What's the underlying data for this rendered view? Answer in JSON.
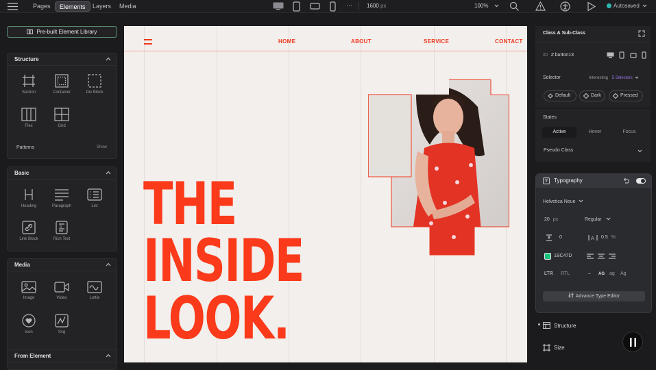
{
  "topbar": {
    "tabs": [
      "Pages",
      "Elements",
      "Layers",
      "Media"
    ],
    "active_tab": "Elements",
    "more": "···",
    "width_value": "1600",
    "width_unit": "px",
    "zoom": "100%",
    "autosave": "Autosaved"
  },
  "left": {
    "library_button": "Pre-built Element Library",
    "structure": {
      "title": "Structure",
      "items": [
        "Section",
        "Container",
        "Div Block",
        "Flex",
        "Grid"
      ],
      "patterns": "Patterns",
      "show": "Show"
    },
    "basic": {
      "title": "Basic",
      "items": [
        "Heading",
        "Paragraph",
        "List",
        "Link Block",
        "Rich Text"
      ]
    },
    "media": {
      "title": "Media",
      "items": [
        "Image",
        "Video",
        "Lottie",
        "Icon",
        "Svg"
      ]
    },
    "from_element": {
      "title": "From Element"
    }
  },
  "canvas": {
    "nav": [
      "HOME",
      "ABOUT",
      "SERVICE",
      "CONTACT"
    ],
    "hero": [
      "THE",
      "INSIDE",
      "LOOK."
    ],
    "accent": "#FA3A1A",
    "background": "#F2EFEC"
  },
  "right": {
    "class_title": "Class & Sub-Class",
    "id_label": "ID",
    "id_value": "# button13",
    "selector_label": "Selector",
    "selector_interesting": "Interesting",
    "selector_count": "5 Selectors",
    "selector_pills": [
      "Default",
      "Dark",
      "Pressed"
    ],
    "states_label": "States",
    "states": [
      "Active",
      "Hover",
      "Focus"
    ],
    "pseudo": "Pseudo Class",
    "typography": {
      "title": "Typography",
      "font": "Helvetica Neue",
      "size": "20",
      "size_unit": "px",
      "weight": "Regular",
      "line_height": "0",
      "letter_spacing": "0.5",
      "letter_unit": "%",
      "color": "1BC47D",
      "color_hex": "#1BC47D",
      "dir": [
        "LTR",
        "RTL"
      ],
      "case": [
        "–",
        "AG",
        "ag",
        "Ag"
      ],
      "advance": "Advance Type Editor"
    },
    "structure": "Structure",
    "size": "Size"
  }
}
